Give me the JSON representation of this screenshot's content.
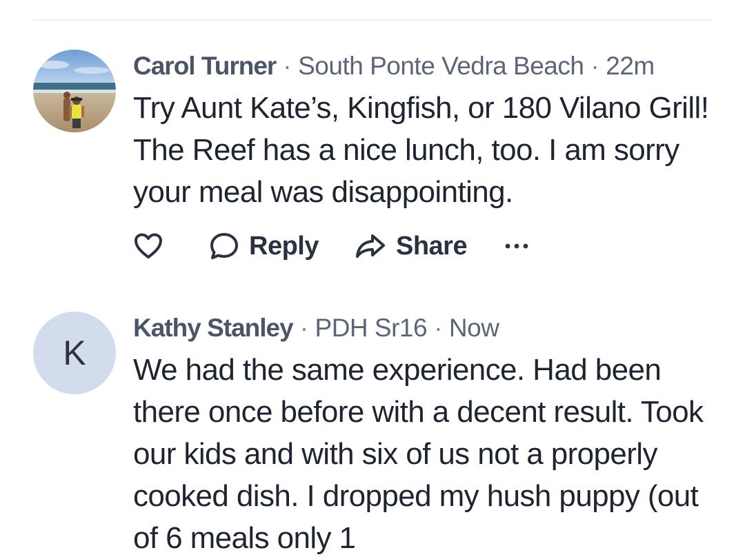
{
  "comments": [
    {
      "author": "Carol Turner",
      "location": "South Ponte Vedra Beach",
      "time": "22m",
      "avatar": {
        "type": "photo",
        "icon": "beach-photo-avatar"
      },
      "text": "Try Aunt Kate’s, Kingfish, or 180 Vilano Grill! The Reef has a nice lunch, too. I am sorry your meal was disappointing.",
      "actions": {
        "reply_label": "Reply",
        "share_label": "Share"
      }
    },
    {
      "author": "Kathy Stanley",
      "location": "PDH Sr16",
      "time": "Now",
      "avatar": {
        "type": "initial",
        "letter": "K",
        "color": "#d3dced"
      },
      "text": "We had the same experience. Had been there once before with a decent result. Took our kids and with six of us not a properly cooked dish. I dropped my hush puppy (out of 6 meals only 1"
    }
  ],
  "icons": {
    "like": "heart-icon",
    "reply": "speech-bubble-icon",
    "share": "share-arrow-icon",
    "more": "ellipsis-icon"
  },
  "colors": {
    "author": "#4c5567",
    "meta": "#5b6577",
    "text": "#1f2530",
    "avatar_bg": "#d3dced",
    "divider": "#eceff3"
  }
}
